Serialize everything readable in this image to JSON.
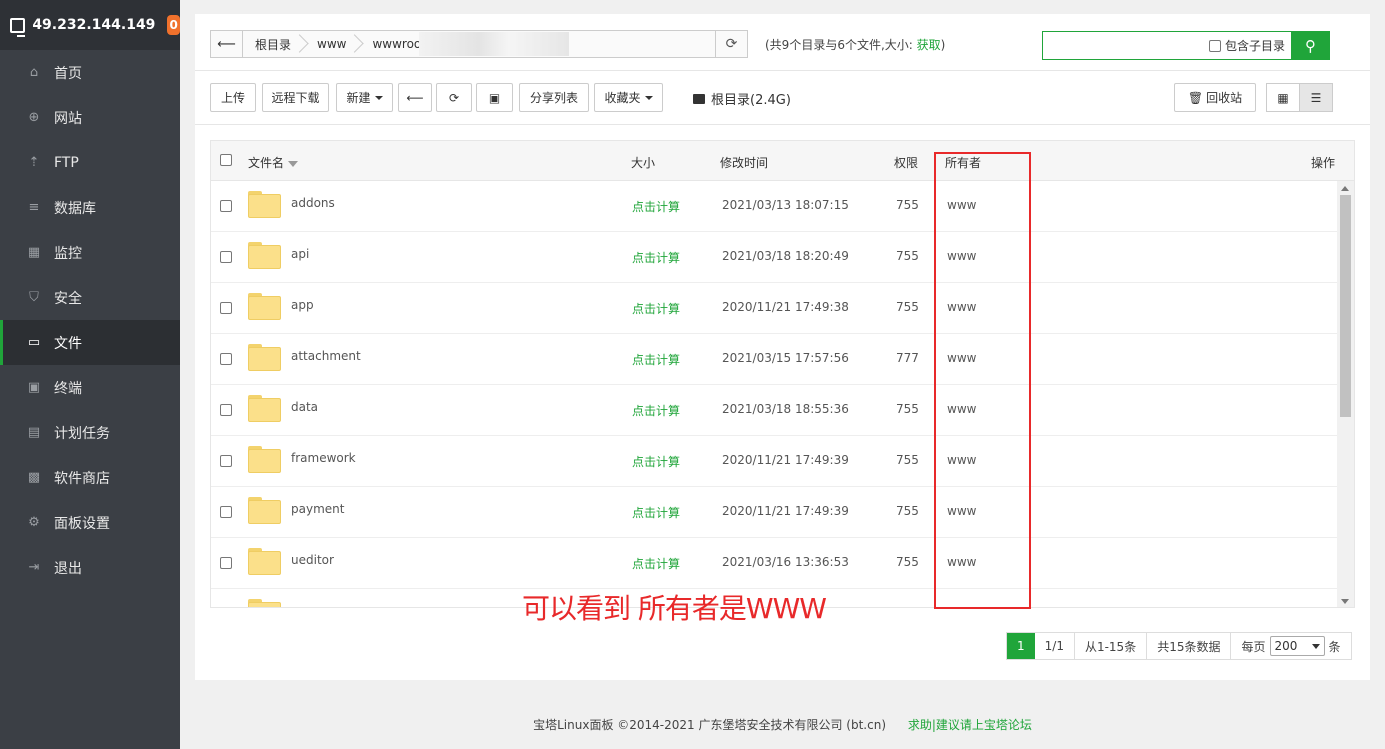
{
  "server": {
    "ip": "49.232.144.149",
    "badge": "0"
  },
  "sidebar": {
    "items": [
      {
        "label": "首页",
        "icon": "home-icon",
        "glyph": "⌂"
      },
      {
        "label": "网站",
        "icon": "globe-icon",
        "glyph": "⊕"
      },
      {
        "label": "FTP",
        "icon": "ftp-icon",
        "glyph": "⇡"
      },
      {
        "label": "数据库",
        "icon": "database-icon",
        "glyph": "≡"
      },
      {
        "label": "监控",
        "icon": "monitor-chart-icon",
        "glyph": "▦"
      },
      {
        "label": "安全",
        "icon": "shield-icon",
        "glyph": "⛉"
      },
      {
        "label": "文件",
        "icon": "folder-icon",
        "glyph": "▭"
      },
      {
        "label": "终端",
        "icon": "terminal-icon",
        "glyph": "▣"
      },
      {
        "label": "计划任务",
        "icon": "calendar-icon",
        "glyph": "▤"
      },
      {
        "label": "软件商店",
        "icon": "apps-grid-icon",
        "glyph": "▩"
      },
      {
        "label": "面板设置",
        "icon": "gear-icon",
        "glyph": "⚙"
      },
      {
        "label": "退出",
        "icon": "logout-icon",
        "glyph": "⇥"
      }
    ],
    "active_index": 6
  },
  "path": {
    "crumbs": [
      "根目录",
      "www",
      "wwwroo"
    ],
    "info_prefix": "(共9个目录与6个文件,大小: ",
    "info_link": "获取",
    "info_suffix": ")"
  },
  "search": {
    "placeholder": "",
    "include_sub_label": "包含子目录"
  },
  "toolbar": {
    "upload": "上传",
    "remote_download": "远程下载",
    "new": "新建",
    "share_list": "分享列表",
    "favorites": "收藏夹",
    "disk_label": "根目录(2.4G)",
    "recycle": "回收站"
  },
  "table": {
    "headers": {
      "name": "文件名",
      "size": "大小",
      "mtime": "修改时间",
      "perm": "权限",
      "owner": "所有者",
      "ops": "操作"
    },
    "rows": [
      {
        "name": "addons",
        "size": "点击计算",
        "mtime": "2021/03/13 18:07:15",
        "perm": "755",
        "owner": "www"
      },
      {
        "name": "api",
        "size": "点击计算",
        "mtime": "2021/03/18 18:20:49",
        "perm": "755",
        "owner": "www"
      },
      {
        "name": "app",
        "size": "点击计算",
        "mtime": "2020/11/21 17:49:38",
        "perm": "755",
        "owner": "www"
      },
      {
        "name": "attachment",
        "size": "点击计算",
        "mtime": "2021/03/15 17:57:56",
        "perm": "777",
        "owner": "www"
      },
      {
        "name": "data",
        "size": "点击计算",
        "mtime": "2021/03/18 18:55:36",
        "perm": "755",
        "owner": "www"
      },
      {
        "name": "framework",
        "size": "点击计算",
        "mtime": "2020/11/21 17:49:39",
        "perm": "755",
        "owner": "www"
      },
      {
        "name": "payment",
        "size": "点击计算",
        "mtime": "2020/11/21 17:49:39",
        "perm": "755",
        "owner": "www"
      },
      {
        "name": "ueditor",
        "size": "点击计算",
        "mtime": "2021/03/16 13:36:53",
        "perm": "755",
        "owner": "www"
      }
    ]
  },
  "annotation": {
    "text": "可以看到 所有者是WWW",
    "color": "#e8292a"
  },
  "pagination": {
    "current": "1",
    "pages": "1/1",
    "range": "从1-15条",
    "total": "共15条数据",
    "per_page_label": "每页",
    "per_page_value": "200",
    "per_page_unit": "条"
  },
  "footer": {
    "copyright": "宝塔Linux面板 ©2014-2021 广东堡塔安全技术有限公司 (bt.cn)",
    "help": "求助|建议请上宝塔论坛"
  },
  "colors": {
    "accent": "#20a53a",
    "sidebar_bg": "#3b3f45",
    "badge": "#f0712c"
  }
}
